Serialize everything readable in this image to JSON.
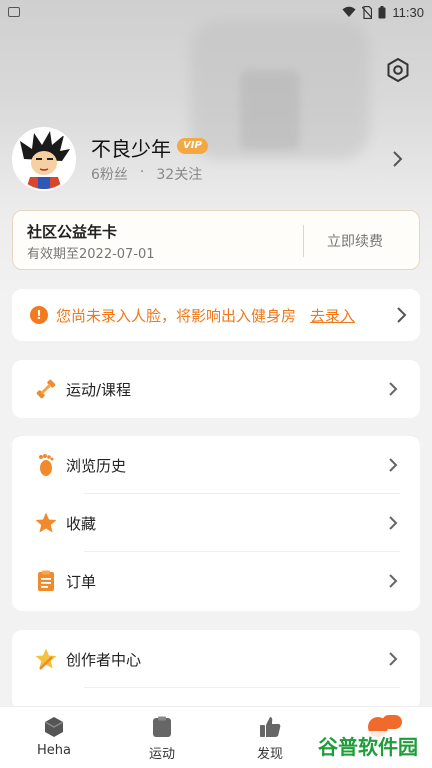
{
  "status_bar": {
    "time": "11:30"
  },
  "profile": {
    "name": "不良少年",
    "vip_badge": "VIP",
    "fans": "6粉丝",
    "separator": "·",
    "following": "32关注"
  },
  "annual_card": {
    "title": "社区公益年卡",
    "expiry": "有效期至2022-07-01",
    "renew_label": "立即续费"
  },
  "face_notice": {
    "message": "您尚未录入人脸，将影响出入健身房",
    "action": "去录入"
  },
  "menu": {
    "sport": "运动/课程",
    "history": "浏览历史",
    "favorites": "收藏",
    "orders": "订单",
    "creator": "创作者中心"
  },
  "tabs": [
    {
      "label": "Heha",
      "icon": "heha-icon"
    },
    {
      "label": "运动",
      "icon": "clipboard-icon"
    },
    {
      "label": "发现",
      "icon": "thumbs-up-icon"
    },
    {
      "label": "",
      "icon": "profile-icon"
    }
  ],
  "watermark": "谷普软件园",
  "colors": {
    "accent": "#f0781b",
    "vip": "#f3a843",
    "badge": "#f06a2b"
  }
}
